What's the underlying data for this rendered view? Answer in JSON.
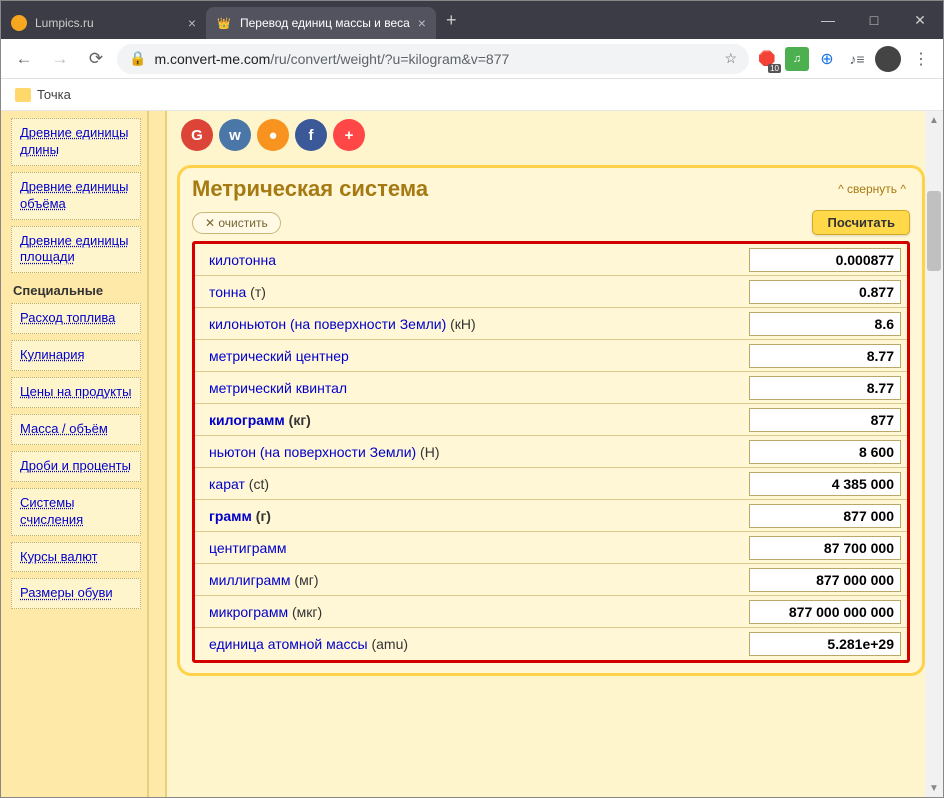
{
  "browser": {
    "tabs": [
      {
        "title": "Lumpics.ru",
        "active": false
      },
      {
        "title": "Перевод единиц массы и веса",
        "active": true
      }
    ],
    "newtab": "+",
    "win": {
      "min": "—",
      "max": "□",
      "close": "✕"
    },
    "url_host": "m.convert-me.com",
    "url_path": "/ru/convert/weight/?u=kilogram&v=877",
    "star": "☆",
    "ext_badge": "10",
    "ext_music": "♫",
    "bookmarks": {
      "folder_label": "Точка"
    }
  },
  "sidebar": {
    "items1": [
      "Древние единицы длины",
      "Древние единицы объёма",
      "Древние единицы площади"
    ],
    "heading": "Специальные",
    "items2": [
      "Расход топлива",
      "Кулинария",
      "Цены на продукты",
      "Масса / объём",
      "Дроби и проценты",
      "Системы счисления",
      "Курсы валют",
      "Размеры обуви"
    ]
  },
  "social": {
    "g": "G",
    "vk": "w",
    "ok": "●",
    "fb": "f",
    "plus": "+"
  },
  "panel": {
    "title": "Метрическая система",
    "collapse": "^ свернуть ^",
    "clear": "✕ очистить",
    "calculate": "Посчитать"
  },
  "rows": [
    {
      "name": "килотонна",
      "abbr": "",
      "bold": false,
      "value": "0.000877"
    },
    {
      "name": "тонна",
      "abbr": " (т)",
      "bold": false,
      "value": "0.877"
    },
    {
      "name": "килоньютон (на поверхности Земли)",
      "abbr": " (кН)",
      "bold": false,
      "value": "8.6"
    },
    {
      "name": "метрический центнер",
      "abbr": "",
      "bold": false,
      "value": "8.77"
    },
    {
      "name": "метрический квинтал",
      "abbr": "",
      "bold": false,
      "value": "8.77"
    },
    {
      "name": "килограмм",
      "abbr": " (кг)",
      "bold": true,
      "value": "877"
    },
    {
      "name": "ньютон (на поверхности Земли)",
      "abbr": " (Н)",
      "bold": false,
      "value": "8 600"
    },
    {
      "name": "карат",
      "abbr": " (ct)",
      "bold": false,
      "value": "4 385 000"
    },
    {
      "name": "грамм",
      "abbr": " (г)",
      "bold": true,
      "value": "877 000"
    },
    {
      "name": "центиграмм",
      "abbr": "",
      "bold": false,
      "value": "87 700 000"
    },
    {
      "name": "миллиграмм",
      "abbr": " (мг)",
      "bold": false,
      "value": "877 000 000"
    },
    {
      "name": "микрограмм",
      "abbr": " (мкг)",
      "bold": false,
      "value": "877 000 000 000"
    },
    {
      "name": "единица атомной массы",
      "abbr": " (amu)",
      "bold": false,
      "value": "5.281e+29"
    }
  ]
}
